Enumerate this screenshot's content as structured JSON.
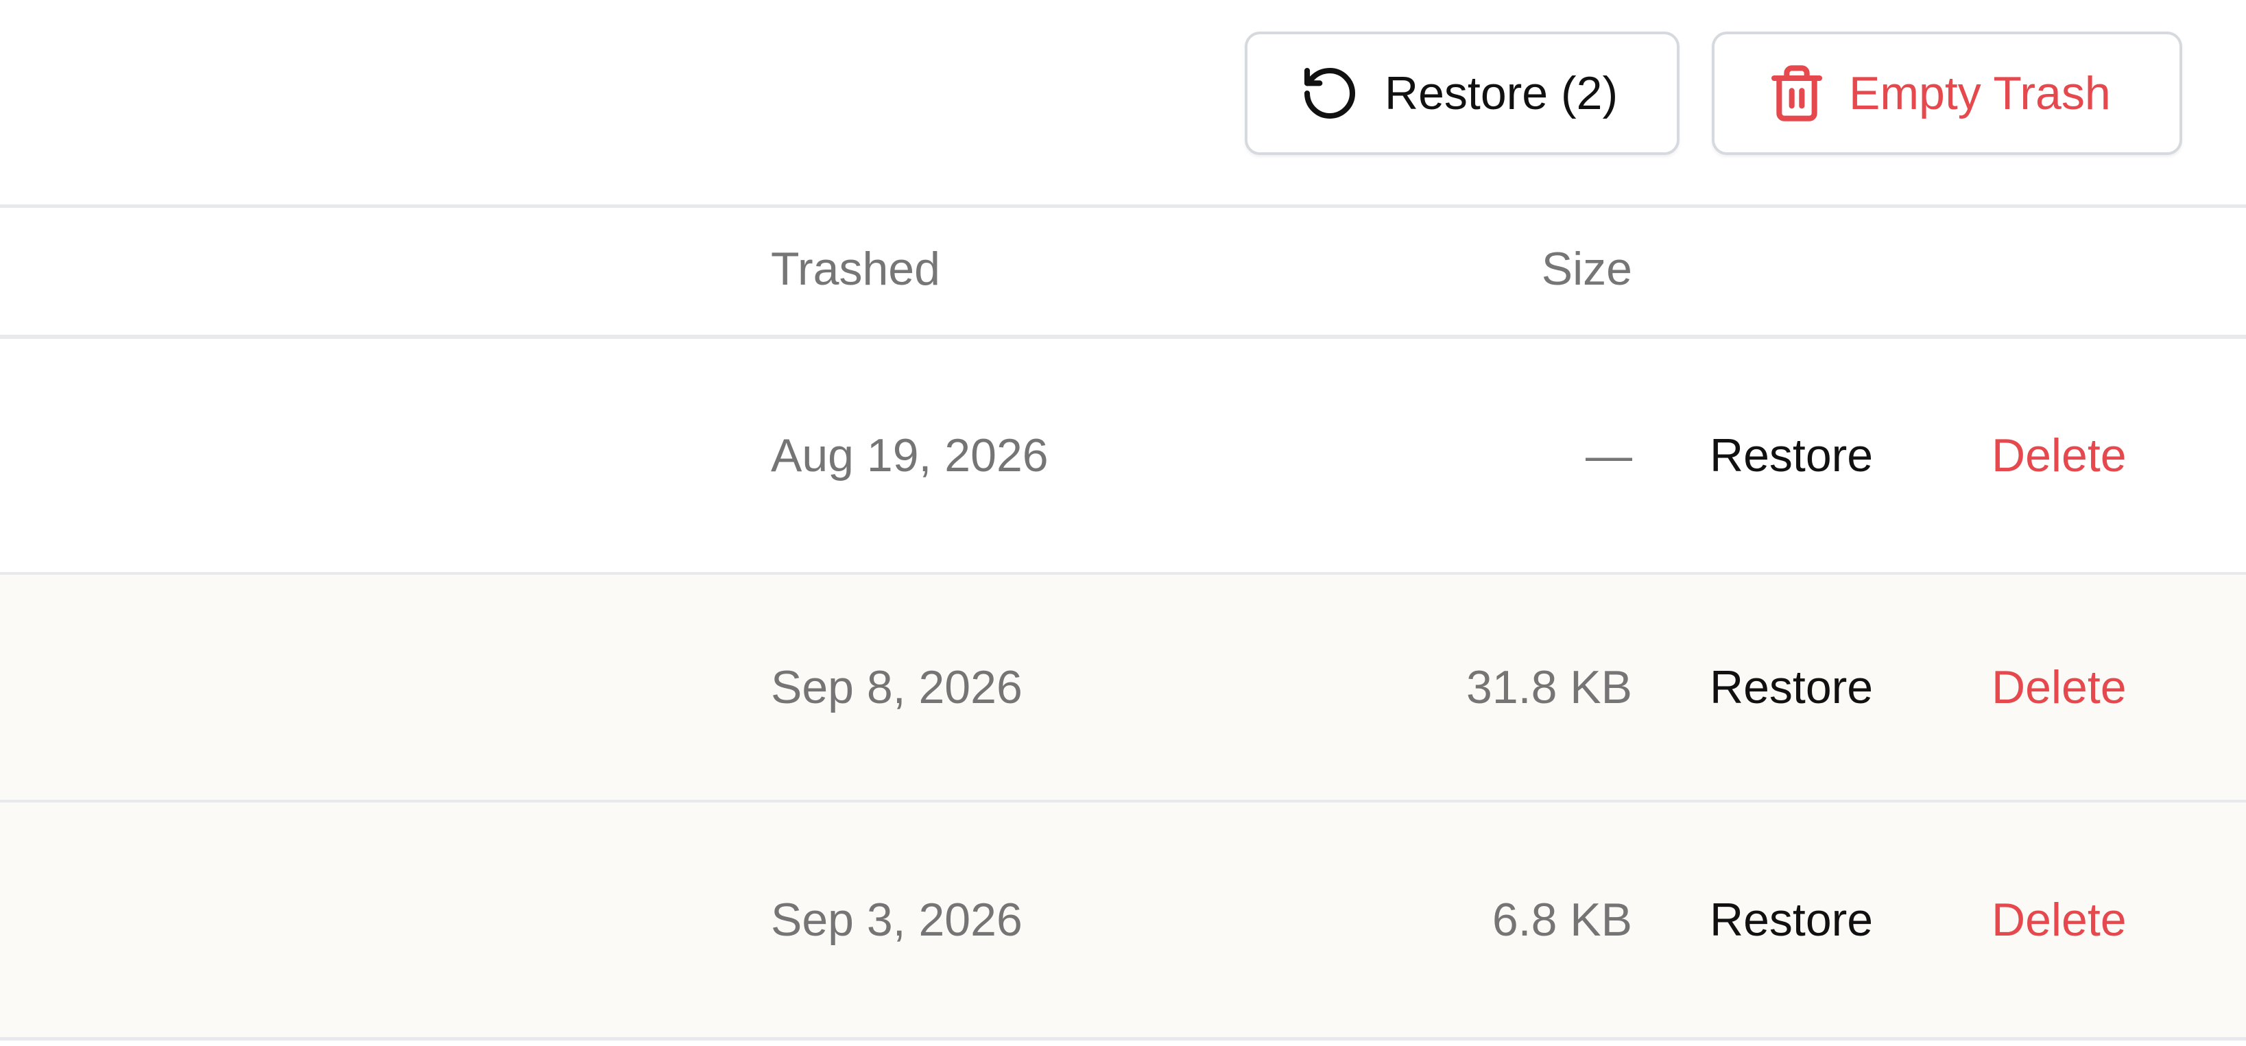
{
  "toolbar": {
    "restore_label": "Restore (2)",
    "empty_trash_label": "Empty Trash"
  },
  "table": {
    "columns": [
      "Trashed",
      "Size"
    ],
    "rows": [
      {
        "trashed": "Aug 19, 2026",
        "size": "—",
        "restore": "Restore",
        "delete": "Delete"
      },
      {
        "trashed": "Sep 8, 2026",
        "size": "31.8 KB",
        "restore": "Restore",
        "delete": "Delete"
      },
      {
        "trashed": "Sep 3, 2026",
        "size": "6.8 KB",
        "restore": "Restore",
        "delete": "Delete"
      }
    ]
  },
  "colors": {
    "danger": "#e5484d",
    "selected_row_bg": "#fcfaf6",
    "muted_text": "#757575",
    "border": "#d6d9de"
  },
  "icons": {
    "restore": "rotate-ccw-icon",
    "empty_trash": "trash-icon"
  }
}
